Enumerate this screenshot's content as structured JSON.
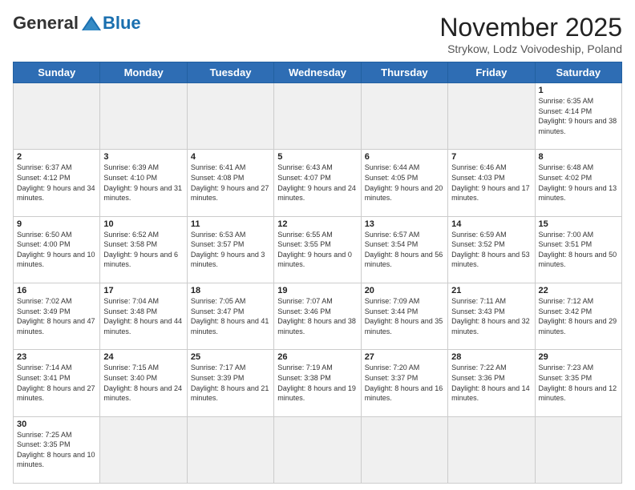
{
  "header": {
    "logo_general": "General",
    "logo_blue": "Blue",
    "month_title": "November 2025",
    "location": "Strykow, Lodz Voivodeship, Poland"
  },
  "days_of_week": [
    "Sunday",
    "Monday",
    "Tuesday",
    "Wednesday",
    "Thursday",
    "Friday",
    "Saturday"
  ],
  "weeks": [
    [
      {
        "day": "",
        "info": "",
        "empty": true
      },
      {
        "day": "",
        "info": "",
        "empty": true
      },
      {
        "day": "",
        "info": "",
        "empty": true
      },
      {
        "day": "",
        "info": "",
        "empty": true
      },
      {
        "day": "",
        "info": "",
        "empty": true
      },
      {
        "day": "",
        "info": "",
        "empty": true
      },
      {
        "day": "1",
        "info": "Sunrise: 6:35 AM\nSunset: 4:14 PM\nDaylight: 9 hours\nand 38 minutes."
      }
    ],
    [
      {
        "day": "2",
        "info": "Sunrise: 6:37 AM\nSunset: 4:12 PM\nDaylight: 9 hours\nand 34 minutes."
      },
      {
        "day": "3",
        "info": "Sunrise: 6:39 AM\nSunset: 4:10 PM\nDaylight: 9 hours\nand 31 minutes."
      },
      {
        "day": "4",
        "info": "Sunrise: 6:41 AM\nSunset: 4:08 PM\nDaylight: 9 hours\nand 27 minutes."
      },
      {
        "day": "5",
        "info": "Sunrise: 6:43 AM\nSunset: 4:07 PM\nDaylight: 9 hours\nand 24 minutes."
      },
      {
        "day": "6",
        "info": "Sunrise: 6:44 AM\nSunset: 4:05 PM\nDaylight: 9 hours\nand 20 minutes."
      },
      {
        "day": "7",
        "info": "Sunrise: 6:46 AM\nSunset: 4:03 PM\nDaylight: 9 hours\nand 17 minutes."
      },
      {
        "day": "8",
        "info": "Sunrise: 6:48 AM\nSunset: 4:02 PM\nDaylight: 9 hours\nand 13 minutes."
      }
    ],
    [
      {
        "day": "9",
        "info": "Sunrise: 6:50 AM\nSunset: 4:00 PM\nDaylight: 9 hours\nand 10 minutes."
      },
      {
        "day": "10",
        "info": "Sunrise: 6:52 AM\nSunset: 3:58 PM\nDaylight: 9 hours\nand 6 minutes."
      },
      {
        "day": "11",
        "info": "Sunrise: 6:53 AM\nSunset: 3:57 PM\nDaylight: 9 hours\nand 3 minutes."
      },
      {
        "day": "12",
        "info": "Sunrise: 6:55 AM\nSunset: 3:55 PM\nDaylight: 9 hours\nand 0 minutes."
      },
      {
        "day": "13",
        "info": "Sunrise: 6:57 AM\nSunset: 3:54 PM\nDaylight: 8 hours\nand 56 minutes."
      },
      {
        "day": "14",
        "info": "Sunrise: 6:59 AM\nSunset: 3:52 PM\nDaylight: 8 hours\nand 53 minutes."
      },
      {
        "day": "15",
        "info": "Sunrise: 7:00 AM\nSunset: 3:51 PM\nDaylight: 8 hours\nand 50 minutes."
      }
    ],
    [
      {
        "day": "16",
        "info": "Sunrise: 7:02 AM\nSunset: 3:49 PM\nDaylight: 8 hours\nand 47 minutes."
      },
      {
        "day": "17",
        "info": "Sunrise: 7:04 AM\nSunset: 3:48 PM\nDaylight: 8 hours\nand 44 minutes."
      },
      {
        "day": "18",
        "info": "Sunrise: 7:05 AM\nSunset: 3:47 PM\nDaylight: 8 hours\nand 41 minutes."
      },
      {
        "day": "19",
        "info": "Sunrise: 7:07 AM\nSunset: 3:46 PM\nDaylight: 8 hours\nand 38 minutes."
      },
      {
        "day": "20",
        "info": "Sunrise: 7:09 AM\nSunset: 3:44 PM\nDaylight: 8 hours\nand 35 minutes."
      },
      {
        "day": "21",
        "info": "Sunrise: 7:11 AM\nSunset: 3:43 PM\nDaylight: 8 hours\nand 32 minutes."
      },
      {
        "day": "22",
        "info": "Sunrise: 7:12 AM\nSunset: 3:42 PM\nDaylight: 8 hours\nand 29 minutes."
      }
    ],
    [
      {
        "day": "23",
        "info": "Sunrise: 7:14 AM\nSunset: 3:41 PM\nDaylight: 8 hours\nand 27 minutes."
      },
      {
        "day": "24",
        "info": "Sunrise: 7:15 AM\nSunset: 3:40 PM\nDaylight: 8 hours\nand 24 minutes."
      },
      {
        "day": "25",
        "info": "Sunrise: 7:17 AM\nSunset: 3:39 PM\nDaylight: 8 hours\nand 21 minutes."
      },
      {
        "day": "26",
        "info": "Sunrise: 7:19 AM\nSunset: 3:38 PM\nDaylight: 8 hours\nand 19 minutes."
      },
      {
        "day": "27",
        "info": "Sunrise: 7:20 AM\nSunset: 3:37 PM\nDaylight: 8 hours\nand 16 minutes."
      },
      {
        "day": "28",
        "info": "Sunrise: 7:22 AM\nSunset: 3:36 PM\nDaylight: 8 hours\nand 14 minutes."
      },
      {
        "day": "29",
        "info": "Sunrise: 7:23 AM\nSunset: 3:35 PM\nDaylight: 8 hours\nand 12 minutes."
      }
    ],
    [
      {
        "day": "30",
        "info": "Sunrise: 7:25 AM\nSunset: 3:35 PM\nDaylight: 8 hours\nand 10 minutes."
      },
      {
        "day": "",
        "info": "",
        "empty": true
      },
      {
        "day": "",
        "info": "",
        "empty": true
      },
      {
        "day": "",
        "info": "",
        "empty": true
      },
      {
        "day": "",
        "info": "",
        "empty": true
      },
      {
        "day": "",
        "info": "",
        "empty": true
      },
      {
        "day": "",
        "info": "",
        "empty": true
      }
    ]
  ]
}
